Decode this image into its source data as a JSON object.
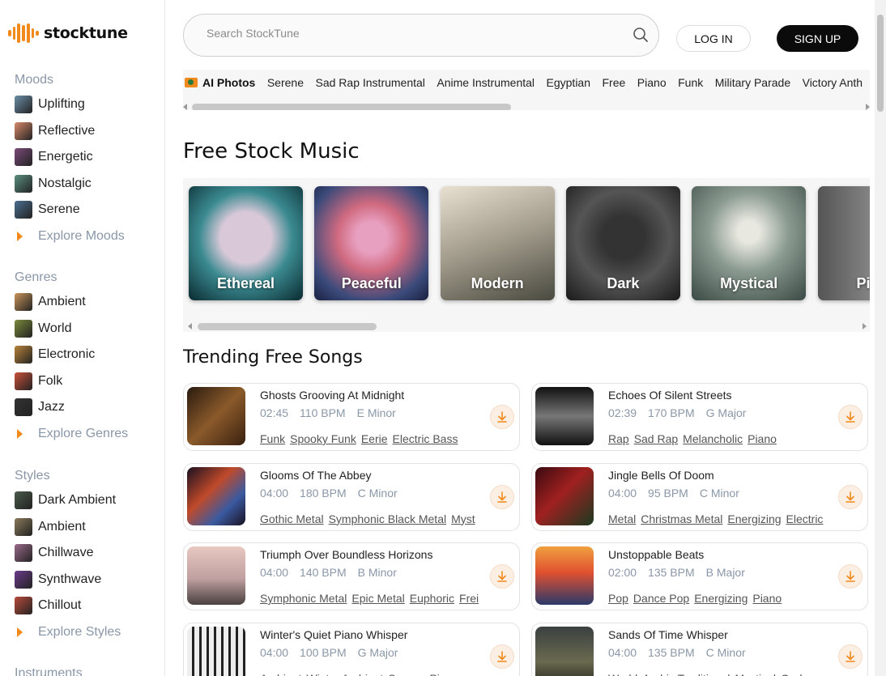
{
  "brand": {
    "name": "stocktune"
  },
  "sidebar": {
    "moods": {
      "heading": "Moods",
      "items": [
        {
          "label": "Uplifting",
          "color": "#6b8fa8"
        },
        {
          "label": "Reflective",
          "color": "#d98a6a"
        },
        {
          "label": "Energetic",
          "color": "#7b4a7a"
        },
        {
          "label": "Nostalgic",
          "color": "#5a8f7f"
        },
        {
          "label": "Serene",
          "color": "#4a6f8f"
        }
      ],
      "explore": "Explore Moods"
    },
    "genres": {
      "heading": "Genres",
      "items": [
        {
          "label": "Ambient",
          "color": "#c9955a"
        },
        {
          "label": "World",
          "color": "#7a8a3a"
        },
        {
          "label": "Electronic",
          "color": "#b8843a"
        },
        {
          "label": "Folk",
          "color": "#c9503a"
        },
        {
          "label": "Jazz",
          "color": "#333333"
        }
      ],
      "explore": "Explore Genres"
    },
    "styles": {
      "heading": "Styles",
      "items": [
        {
          "label": "Dark Ambient",
          "color": "#4a5a4a"
        },
        {
          "label": "Ambient",
          "color": "#8a7a5a"
        },
        {
          "label": "Chillwave",
          "color": "#9a6a8a"
        },
        {
          "label": "Synthwave",
          "color": "#6a3a8a"
        },
        {
          "label": "Chillout",
          "color": "#b84a3a"
        }
      ],
      "explore": "Explore Styles"
    },
    "instruments": {
      "heading": "Instruments"
    }
  },
  "header": {
    "search_placeholder": "Search StockTune",
    "login": "LOG IN",
    "signup": "SIGN UP"
  },
  "tags": [
    "AI Photos",
    "Serene",
    "Sad Rap Instrumental",
    "Anime Instrumental",
    "Egyptian",
    "Free",
    "Piano",
    "Funk",
    "Military Parade",
    "Victory Anth"
  ],
  "free_section": {
    "title": "Free Stock Music",
    "moods": [
      "Ethereal",
      "Peaceful",
      "Modern",
      "Dark",
      "Mystical",
      "Pi"
    ]
  },
  "trending": {
    "title": "Trending Free Songs",
    "songs": [
      {
        "title": "Ghosts Grooving At Midnight",
        "duration": "02:45",
        "bpm": "110 BPM",
        "key": "E Minor",
        "tags": [
          "Funk",
          "Spooky Funk",
          "Eerie",
          "Electric Bass"
        ],
        "art": "linear-gradient(135deg,#2a1a10,#8a5a2a 50%,#3a2010)"
      },
      {
        "title": "Echoes Of Silent Streets",
        "duration": "02:39",
        "bpm": "170 BPM",
        "key": "G Major",
        "tags": [
          "Rap",
          "Sad Rap",
          "Melancholic",
          "Piano"
        ],
        "art": "linear-gradient(180deg,#111,#777 50%,#111)"
      },
      {
        "title": "Glooms Of The Abbey",
        "duration": "04:00",
        "bpm": "180 BPM",
        "key": "C Minor",
        "tags": [
          "Gothic Metal",
          "Symphonic Black Metal",
          "Myst"
        ],
        "art": "linear-gradient(135deg,#1a1020,#c04a2a 40%,#3a5aa0 70%,#1a1020)"
      },
      {
        "title": "Jingle Bells Of Doom",
        "duration": "04:00",
        "bpm": "95 BPM",
        "key": "C Minor",
        "tags": [
          "Metal",
          "Christmas Metal",
          "Energizing",
          "Electric"
        ],
        "art": "linear-gradient(135deg,#3a0a10,#a02020 45%,#1a3a20)"
      },
      {
        "title": "Triumph Over Boundless Horizons",
        "duration": "04:00",
        "bpm": "140 BPM",
        "key": "B Minor",
        "tags": [
          "Symphonic Metal",
          "Epic Metal",
          "Euphoric",
          "Frei"
        ],
        "art": "linear-gradient(180deg,#e8c8c0,#c0a0a0 55%,#4a4040)"
      },
      {
        "title": "Unstoppable Beats",
        "duration": "02:00",
        "bpm": "135 BPM",
        "key": "B Major",
        "tags": [
          "Pop",
          "Dance Pop",
          "Energizing",
          "Piano"
        ],
        "art": "linear-gradient(180deg,#f0a040,#e05030 45%,#2a3a6a)"
      },
      {
        "title": "Winter's Quiet Piano Whisper",
        "duration": "04:00",
        "bpm": "100 BPM",
        "key": "G Major",
        "tags": [
          "Ambient",
          "Winter Ambient",
          "Serene",
          "Piano"
        ],
        "art": "repeating-linear-gradient(90deg,#eee 0 6px,#222 6px 9px)"
      },
      {
        "title": "Sands Of Time Whisper",
        "duration": "04:00",
        "bpm": "135 BPM",
        "key": "C Minor",
        "tags": [
          "World",
          "Arabic Traditional",
          "Mystical",
          "Oud"
        ],
        "art": "linear-gradient(180deg,#3a4040,#6a6a50 60%,#2a2a20)"
      }
    ]
  },
  "colors": {
    "accent": "#f28a1b",
    "muted": "#8a97a8"
  }
}
